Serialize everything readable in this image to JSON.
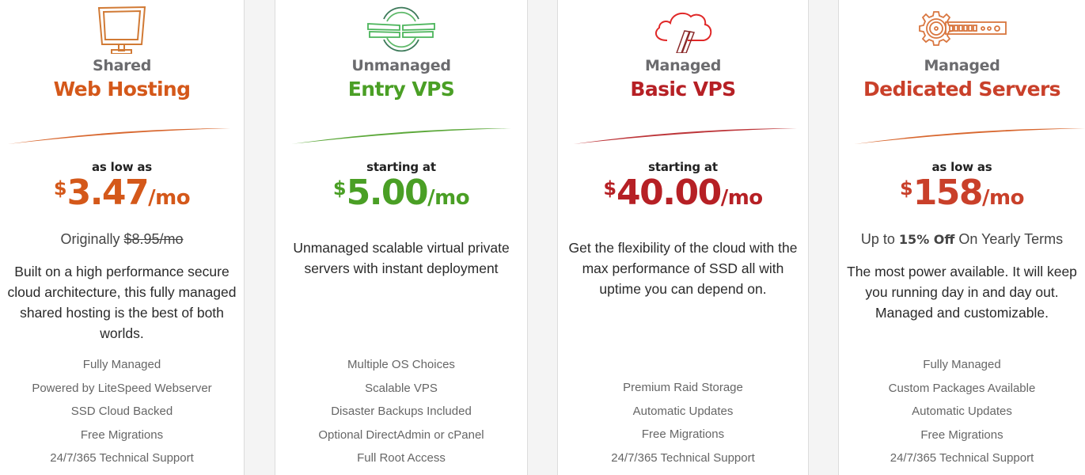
{
  "colors": {
    "shared": "#d4581a",
    "entry_vps": "#4a9f25",
    "basic_vps": "#b62025",
    "dedicated": "#c9402a",
    "tier_gray": "#6b6b6e"
  },
  "plans": [
    {
      "icon": "monitor-icon",
      "tier": "Shared",
      "product": "Web Hosting",
      "lead": "as low as",
      "price": {
        "currency": "$",
        "amount": "3.47",
        "per": "/mo"
      },
      "note": {
        "prefix": "Originally ",
        "strike": "$8.95/mo"
      },
      "description": "Built on a high performance secure cloud architecture, this fully managed shared hosting is the best of both worlds.",
      "features": [
        "Fully Managed",
        "Powered by LiteSpeed Webserver",
        "SSD Cloud Backed",
        "Free Migrations",
        "24/7/365 Technical Support"
      ]
    },
    {
      "icon": "server-globe-icon",
      "tier": "Unmanaged",
      "product": "Entry VPS",
      "lead": "starting at",
      "price": {
        "currency": "$",
        "amount": "5.00",
        "per": "/mo"
      },
      "description": "Unmanaged scalable virtual private servers with instant deployment",
      "features": [
        "Multiple OS Choices",
        "Scalable VPS",
        "Disaster Backups Included",
        "Optional DirectAdmin or cPanel",
        "Full Root Access"
      ]
    },
    {
      "icon": "cloud-server-icon",
      "tier": "Managed",
      "product": "Basic VPS",
      "lead": "starting at",
      "price": {
        "currency": "$",
        "amount": "40.00",
        "per": "/mo"
      },
      "description": "Get the flexibility of the cloud with the max performance of SSD all with uptime you can depend on.",
      "features": [
        "Premium Raid Storage",
        "Automatic Updates",
        "Free Migrations",
        "24/7/365 Technical Support"
      ]
    },
    {
      "icon": "gear-server-icon",
      "tier": "Managed",
      "product": "Dedicated Servers",
      "lead": "as low as",
      "price": {
        "currency": "$",
        "amount": "158",
        "per": "/mo"
      },
      "note": {
        "prefix": "Up to ",
        "bold": "15% Off",
        "suffix": " On Yearly Terms"
      },
      "description": "The most power available. It will keep you running day in and day out. Managed and customizable.",
      "features": [
        "Fully Managed",
        "Custom Packages Available",
        "Automatic Updates",
        "Free Migrations",
        "24/7/365 Technical Support"
      ]
    }
  ]
}
